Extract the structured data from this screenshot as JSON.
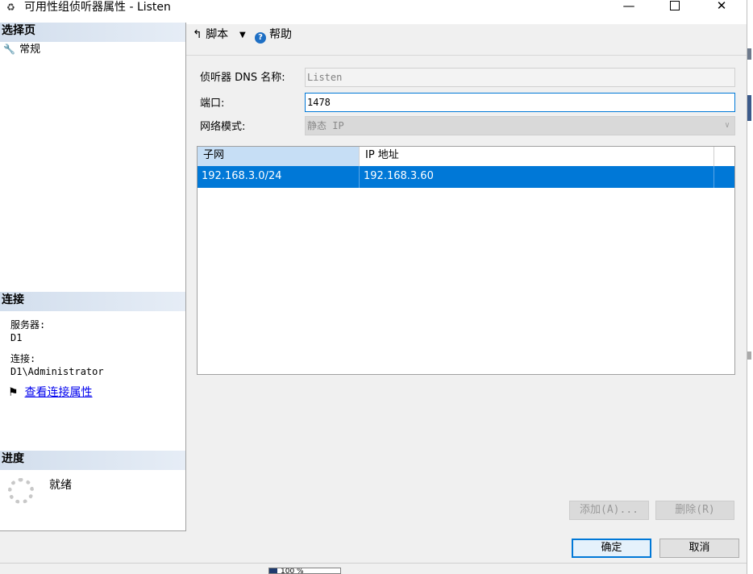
{
  "window": {
    "title": "可用性组侦听器属性 - Listen",
    "minimize": "—",
    "close": "✕"
  },
  "left": {
    "select_page_title": "选择页",
    "nav_items": [
      {
        "label": "常规",
        "icon": "wrench-icon"
      }
    ],
    "connection_title": "连接",
    "server_label": "服务器:",
    "server_value": "D1",
    "connection_label": "连接:",
    "connection_value": "D1\\Administrator",
    "view_props_link": "查看连接属性",
    "progress_title": "进度",
    "progress_status": "就绪"
  },
  "toolbar": {
    "script_label": "脚本",
    "help_label": "帮助"
  },
  "form": {
    "dns_label": "侦听器 DNS 名称:",
    "dns_value": "Listen",
    "port_label": "端口:",
    "port_value": "1478",
    "mode_label": "网络模式:",
    "mode_value": "静态 IP"
  },
  "grid": {
    "columns": [
      "子网",
      "IP 地址"
    ],
    "rows": [
      {
        "subnet": "192.168.3.0/24",
        "ip": "192.168.3.60"
      }
    ]
  },
  "buttons": {
    "add": "添加(A)...",
    "remove": "删除(R)",
    "ok": "确定",
    "cancel": "取消"
  },
  "statusbar": {
    "zoom": "100 %"
  },
  "colors": {
    "selection": "#0078d7",
    "section_header": "#d2deed",
    "link": "#0000ee"
  }
}
